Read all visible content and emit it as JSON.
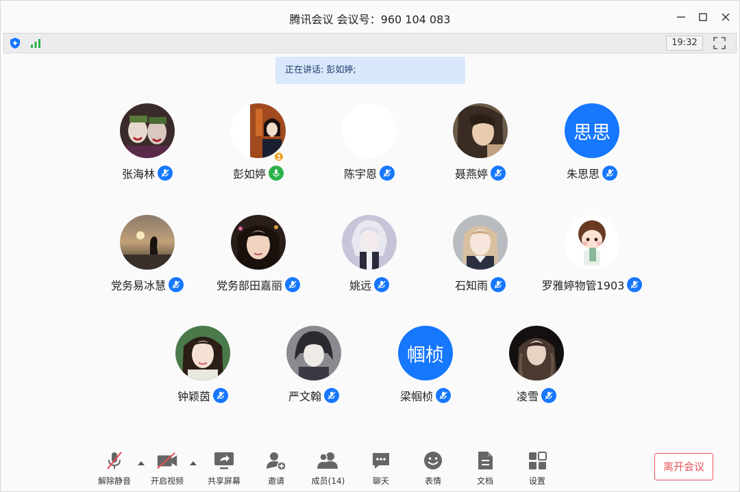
{
  "window": {
    "title": "腾讯会议 会议号：960 104 083"
  },
  "status": {
    "clock": "19:32"
  },
  "speaking": {
    "label": "正在讲话:",
    "name": "彭如婷;"
  },
  "participants": [
    {
      "name": "张海林"
    },
    {
      "name": "彭如婷"
    },
    {
      "name": "陈宇恩"
    },
    {
      "name": "聂燕婷"
    },
    {
      "name": "朱思思",
      "avatar_text": "思思"
    },
    {
      "name": "党务易冰慧"
    },
    {
      "name": "党务部田嘉丽"
    },
    {
      "name": "姚远"
    },
    {
      "name": "石知雨"
    },
    {
      "name": "罗雅婷物管1903"
    },
    {
      "name": "钟颖茵"
    },
    {
      "name": "严文翰"
    },
    {
      "name": "梁帼桢",
      "avatar_text": "帼桢"
    },
    {
      "name": "凌雪"
    }
  ],
  "toolbar": {
    "unmute": "解除静音",
    "start_video": "开启视频",
    "share_screen": "共享屏幕",
    "invite": "邀请",
    "members": "成员(14)",
    "chat": "聊天",
    "reactions": "表情",
    "docs": "文档",
    "settings": "设置",
    "leave": "离开会议"
  },
  "colors": {
    "accent": "#1677ff",
    "speaking_mic": "#2cb24a",
    "leave": "#e8525a",
    "banner": "#d9e8fb"
  }
}
